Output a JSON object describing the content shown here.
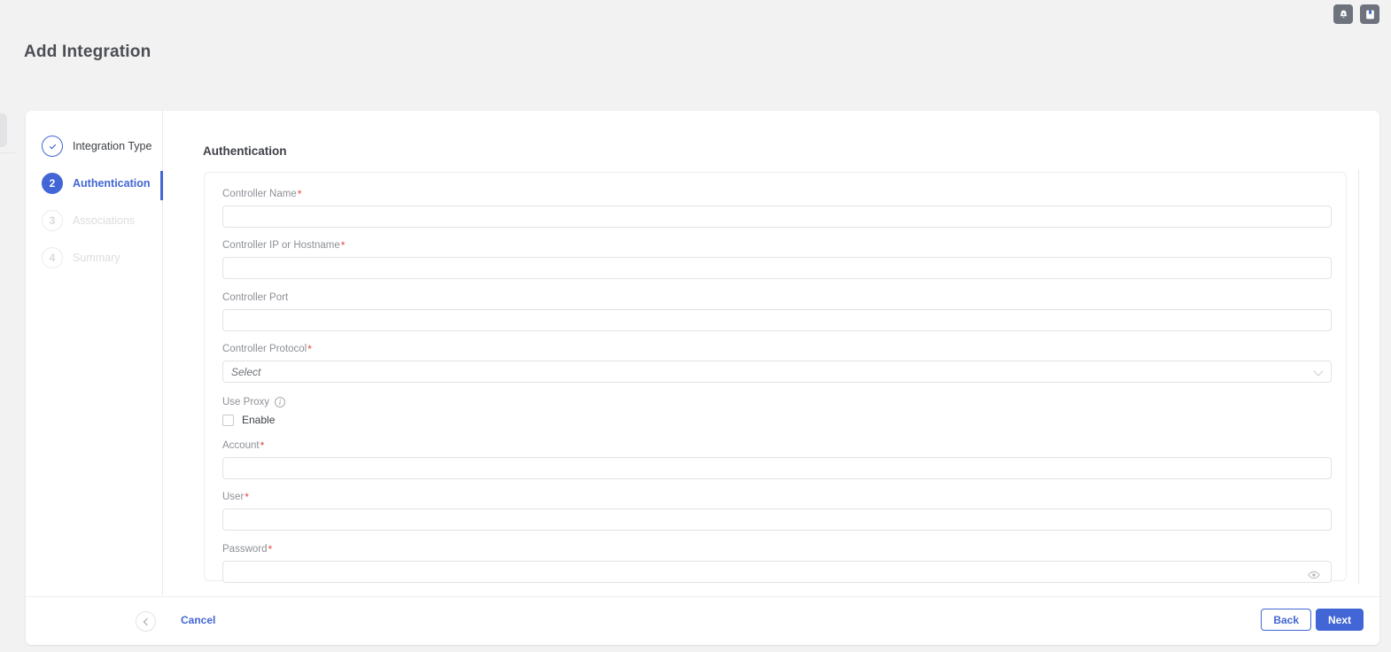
{
  "topbar": {
    "icons": [
      {
        "name": "notification-bell-icon",
        "label": "Notifications"
      },
      {
        "name": "bookmark-icon",
        "label": "Bookmarks"
      }
    ]
  },
  "page": {
    "title": "Add Integration"
  },
  "stepper": {
    "steps": [
      {
        "num": "1",
        "label": "Integration Type",
        "state": "done",
        "marker": "check"
      },
      {
        "num": "2",
        "label": "Authentication",
        "state": "active",
        "marker": "2"
      },
      {
        "num": "3",
        "label": "Associations",
        "state": "todo",
        "marker": "3"
      },
      {
        "num": "4",
        "label": "Summary",
        "state": "todo",
        "marker": "4"
      }
    ]
  },
  "content": {
    "heading": "Authentication",
    "fields": {
      "controller_name": {
        "label": "Controller Name",
        "required": "*",
        "value": "",
        "placeholder": ""
      },
      "controller_host": {
        "label": "Controller IP or Hostname",
        "required": "*",
        "value": "",
        "placeholder": ""
      },
      "controller_port": {
        "label": "Controller Port",
        "required": "",
        "value": "",
        "placeholder": ""
      },
      "controller_protocol": {
        "label": "Controller Protocol",
        "required": "*",
        "selected": "Select"
      },
      "use_proxy": {
        "label": "Use Proxy",
        "info": "i",
        "checkbox_label": "Enable",
        "checked": false
      },
      "account": {
        "label": "Account",
        "required": "*",
        "value": "",
        "placeholder": ""
      },
      "user": {
        "label": "User",
        "required": "*",
        "value": "",
        "placeholder": ""
      },
      "password": {
        "label": "Password",
        "required": "*",
        "value": "",
        "placeholder": ""
      }
    }
  },
  "footer": {
    "cancel_label": "Cancel",
    "back_label": "Back",
    "next_label": "Next"
  },
  "colors": {
    "accent": "#4266d5",
    "required": "#e8453c",
    "page_bg": "#f2f2f3",
    "card_bg": "#ffffff",
    "muted_text": "#8d9096",
    "topicon_bg": "#6d727c"
  }
}
